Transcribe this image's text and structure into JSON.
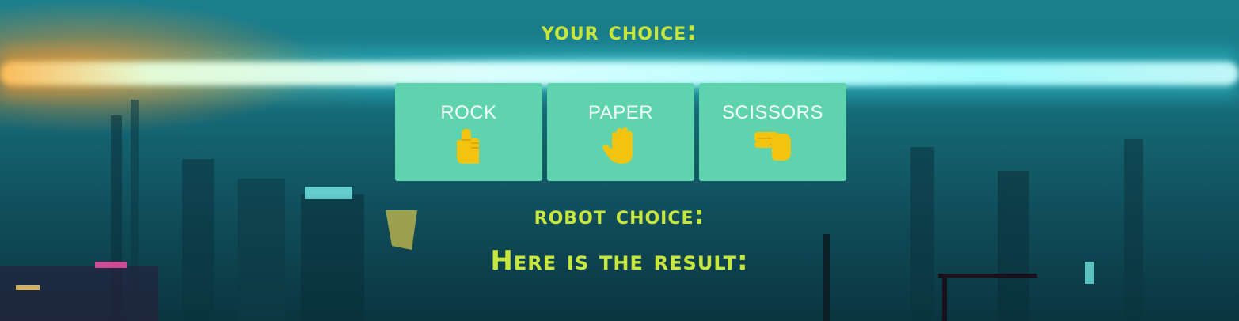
{
  "page": {
    "your_choice_heading": "your choice:",
    "robot_choice_heading": "robot choice:",
    "result_heading": "Here is the result:"
  },
  "choices": [
    {
      "label": "ROCK",
      "icon": "raised-fist-icon"
    },
    {
      "label": "PAPER",
      "icon": "raised-hand-icon"
    },
    {
      "label": "SCISSORS",
      "icon": "pointing-hand-icon"
    }
  ],
  "colors": {
    "heading": "#c8e63c",
    "button_bg": "#5ed3ae",
    "button_text": "#f4fff8",
    "icon": "#f2c40f"
  }
}
